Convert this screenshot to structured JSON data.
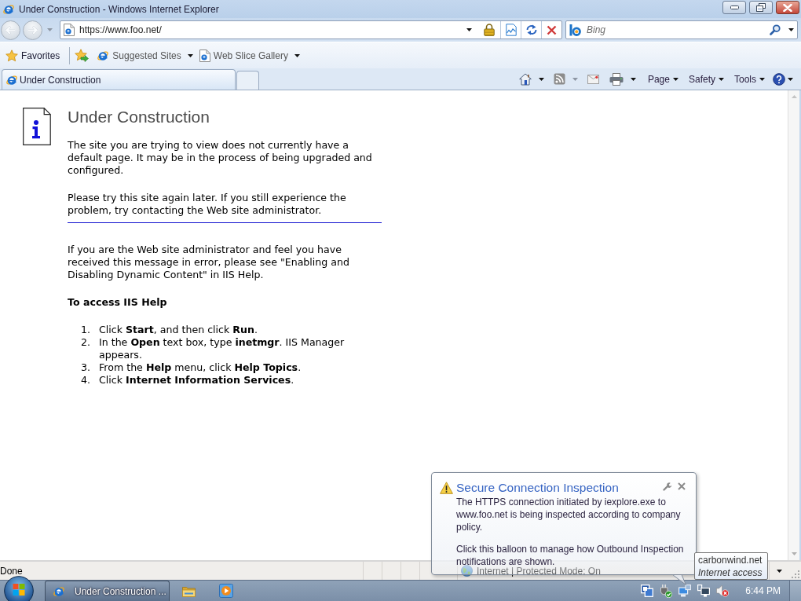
{
  "window": {
    "title": "Under Construction - Windows Internet Explorer"
  },
  "navigation": {
    "back": {
      "disabled": true
    },
    "forward": {
      "disabled": true
    },
    "address": "https://www.foo.net/",
    "search": {
      "placeholder": "Bing"
    }
  },
  "favorites_bar": {
    "favorites": "Favorites",
    "links": [
      "Suggested Sites",
      "Web Slice Gallery"
    ]
  },
  "tabs": [
    {
      "label": "Under Construction",
      "selected": true
    }
  ],
  "command_bar": {
    "feeds": {
      "disabled": true
    },
    "menus": [
      "Page",
      "Safety",
      "Tools"
    ]
  },
  "page": {
    "heading": "Under Construction",
    "paragraphs": [
      "The site you are trying to view does not currently have a default page. It may be in the process of being upgraded and configured.",
      "Please try this site again later. If you still experience the problem, try contacting the Web site administrator."
    ],
    "admin_note": "If you are the Web site administrator and feel you have received this message in error, please see \"Enabling and Disabling Dynamic Content\" in IIS Help.",
    "help_heading": "To access IIS Help",
    "steps": [
      {
        "number": "1.",
        "text": "Click **Start**, and then click **Run**."
      },
      {
        "number": "2.",
        "text": "In the **Open** text box, type **inetmgr**. IIS Manager appears."
      },
      {
        "number": "3.",
        "text": "From the **Help** menu, click **Help Topics**."
      },
      {
        "number": "4.",
        "text": "Click **Internet Information Services**."
      }
    ]
  },
  "status_bar": {
    "text": "Done",
    "zone": "Internet | Protected Mode: On"
  },
  "balloon": {
    "title": "Secure Connection Inspection",
    "paragraphs": [
      "The HTTPS connection initiated by iexplore.exe to www.foo.net is being inspected according to company policy.",
      "Click this balloon to manage how Outbound Inspection notifications are shown."
    ]
  },
  "tooltip": {
    "host": "carbonwind.net",
    "status": "Internet access"
  },
  "taskbar": {
    "tasks": [
      {
        "label": "Under Construction ...",
        "selected": true
      }
    ],
    "clock": "6:44 PM"
  }
}
